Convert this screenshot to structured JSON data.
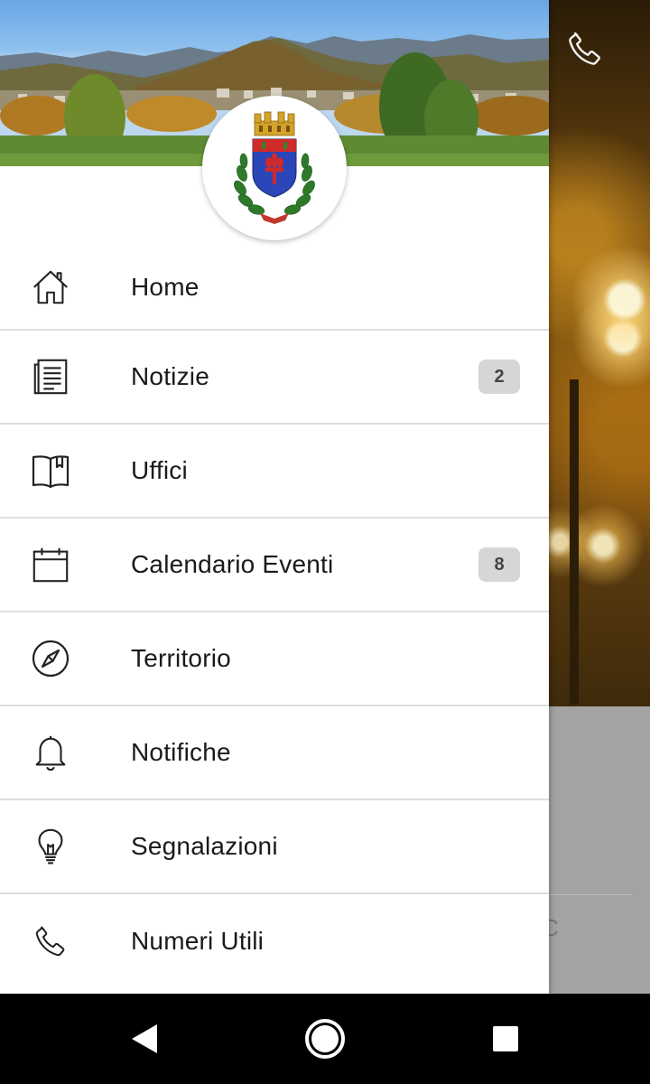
{
  "drawer": {
    "items": [
      {
        "label": "Home",
        "icon": "home-icon",
        "badge": null
      },
      {
        "label": "Notizie",
        "icon": "news-icon",
        "badge": "2"
      },
      {
        "label": "Uffici",
        "icon": "book-icon",
        "badge": null
      },
      {
        "label": "Calendario Eventi",
        "icon": "calendar-icon",
        "badge": "8"
      },
      {
        "label": "Territorio",
        "icon": "compass-icon",
        "badge": null
      },
      {
        "label": "Notifiche",
        "icon": "bell-icon",
        "badge": null
      },
      {
        "label": "Segnalazioni",
        "icon": "lightbulb-icon",
        "badge": null
      },
      {
        "label": "Numeri Utili",
        "icon": "phone-icon",
        "badge": null
      }
    ]
  },
  "background": {
    "partial_text": "C"
  },
  "colors": {
    "drawer_bg": "#ffffff",
    "badge_bg": "#d6d6d6",
    "divider": "#dedede",
    "text": "#1a1a1a"
  }
}
